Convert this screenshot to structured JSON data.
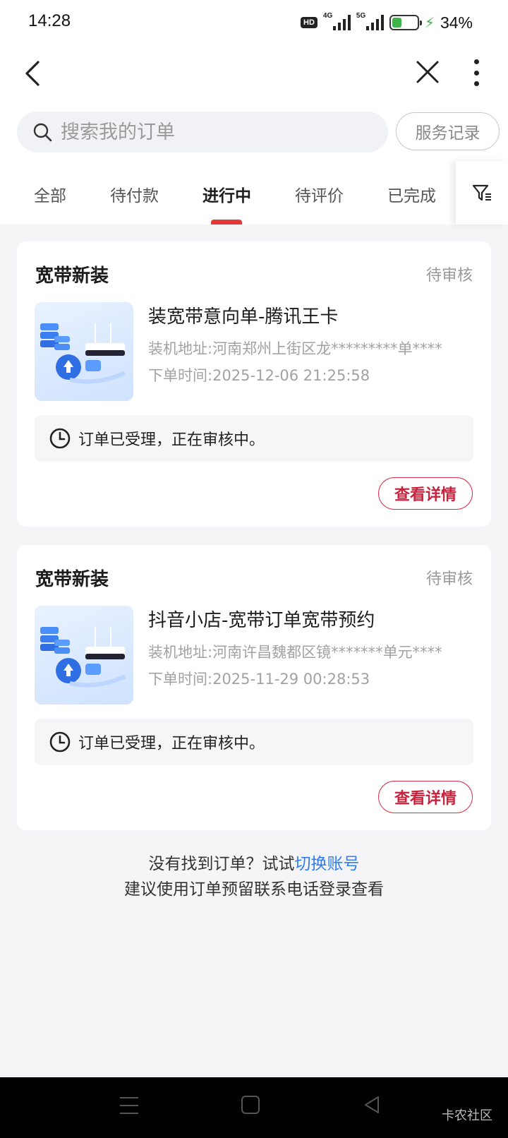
{
  "status_bar": {
    "time": "14:28",
    "hd": "HD",
    "net1": "4G",
    "net2": "5G",
    "battery": "34%",
    "battery_level": 0.34
  },
  "search": {
    "placeholder": "搜索我的订单"
  },
  "service_record_label": "服务记录",
  "tabs": [
    {
      "label": "全部"
    },
    {
      "label": "待付款"
    },
    {
      "label": "进行中"
    },
    {
      "label": "待评价"
    },
    {
      "label": "已完成"
    }
  ],
  "active_tab": "进行中",
  "orders": [
    {
      "type": "宽带新装",
      "status": "待审核",
      "title": "装宽带意向单-腾讯王卡",
      "address_label": "装机地址:",
      "address": "河南郑州上街区龙*********单****",
      "time_label": "下单时间:",
      "time": "2025-12-06 21:25:58",
      "notice": "订单已受理，正在审核中。",
      "button": "查看详情"
    },
    {
      "type": "宽带新装",
      "status": "待审核",
      "title": "抖音小店-宽带订单宽带预约",
      "address_label": "装机地址:",
      "address": "河南许昌魏都区镜*******单元****",
      "time_label": "下单时间:",
      "time": "2025-11-29 00:28:53",
      "notice": "订单已受理，正在审核中。",
      "button": "查看详情"
    }
  ],
  "footer_hint": {
    "prefix": "没有找到订单？试试",
    "link": "切换账号",
    "line2": "建议使用订单预留联系电话登录查看"
  },
  "watermark": "卡农社区",
  "colors": {
    "accent_red": "#e53935",
    "button_red": "#c8233c",
    "link_blue": "#2e7cf6",
    "battery_green": "#3fb24a"
  }
}
